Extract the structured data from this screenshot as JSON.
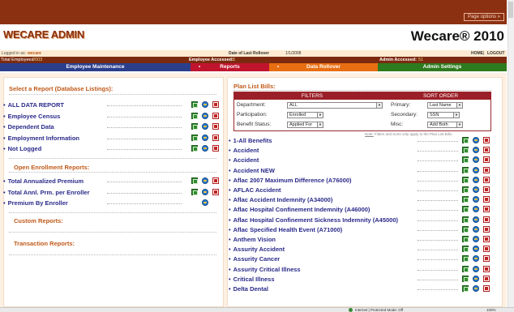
{
  "header": {
    "page_options": "Page options »",
    "logo_text": "WECARE ADMIN",
    "app_title": "Wecare® 2010"
  },
  "info": {
    "logged_in_label": "Logged in as: ",
    "logged_in_user": "wecare",
    "rollover_label": "Date of Last Rollover",
    "rollover_date": "1/1/2008",
    "home": "HOME",
    "sep": "|",
    "logout": "LOGOUT",
    "total_employees_label": "Total Employees: ",
    "total_employees": "2003",
    "emp_accessed_label": "Employee Accessed: ",
    "emp_accessed": "5",
    "admin_accessed_label": "Admin Accessed: ",
    "admin_accessed": "51"
  },
  "nav": {
    "bullet": "•",
    "tabs": [
      {
        "label": "Employee Maintenance",
        "color": "#2b3e8c"
      },
      {
        "label": "Reports",
        "color": "#c0142e"
      },
      {
        "label": "Data Rollover",
        "color": "#e86e12"
      },
      {
        "label": "Admin Settings",
        "color": "#2e7a1e"
      }
    ]
  },
  "left": {
    "db_title": "Select a Report (Database Listings):",
    "db_reports": [
      {
        "label": "ALL DATA REPORT"
      },
      {
        "label": "Employee Census"
      },
      {
        "label": "Dependent Data"
      },
      {
        "label": "Employment Information"
      },
      {
        "label": "Not Logged"
      }
    ],
    "oe_title": "Open Enrollment Reports:",
    "oe_reports": [
      {
        "label": "Total Annualized Premium"
      },
      {
        "label": "Total Annl. Prm. per Enroller"
      },
      {
        "label": "Premium By Enroller"
      }
    ],
    "custom_title": "Custom Reports:",
    "transaction_title": "Transaction Reports:"
  },
  "plan": {
    "title": "Plan List Bills:",
    "filters_header": "FILTERS",
    "sort_header": "SORT ORDER",
    "fields": {
      "department": {
        "label": "Department:",
        "value": "ALL"
      },
      "participation": {
        "label": "Participation:",
        "value": "Enrolled"
      },
      "benefit_status": {
        "label": "Benefit Status:",
        "value": "Applied For"
      },
      "primary": {
        "label": "Primary:",
        "value": "Last Name"
      },
      "secondary": {
        "label": "Secondary:",
        "value": "SSN"
      },
      "misc": {
        "label": "Misc:",
        "value": "Add Both"
      }
    },
    "note_label": "Note:",
    "note_text": "Filters and Sorts only apply to the Plan List Bills.",
    "items": [
      "1-All Benefits",
      "Accident",
      "Accident",
      "Accident NEW",
      "Aflac 2007 Maximum Difference (A76000)",
      "AFLAC Accident",
      "Aflac Accident Indemnity (A34000)",
      "Aflac Hospital Confinement Indemnity (A46000)",
      "Aflac Hospital Confinement Sickness Indemnity (A45000)",
      "Aflac Specified Health Event (A71000)",
      "Anthem Vision",
      "Assurity Accident",
      "Assurity Cancer",
      "Assurity Critical Illness",
      "Critical Illness",
      "Delta Dental"
    ]
  },
  "status": {
    "zone": "Internet | Protected Mode: Off",
    "zoom": "100%"
  }
}
